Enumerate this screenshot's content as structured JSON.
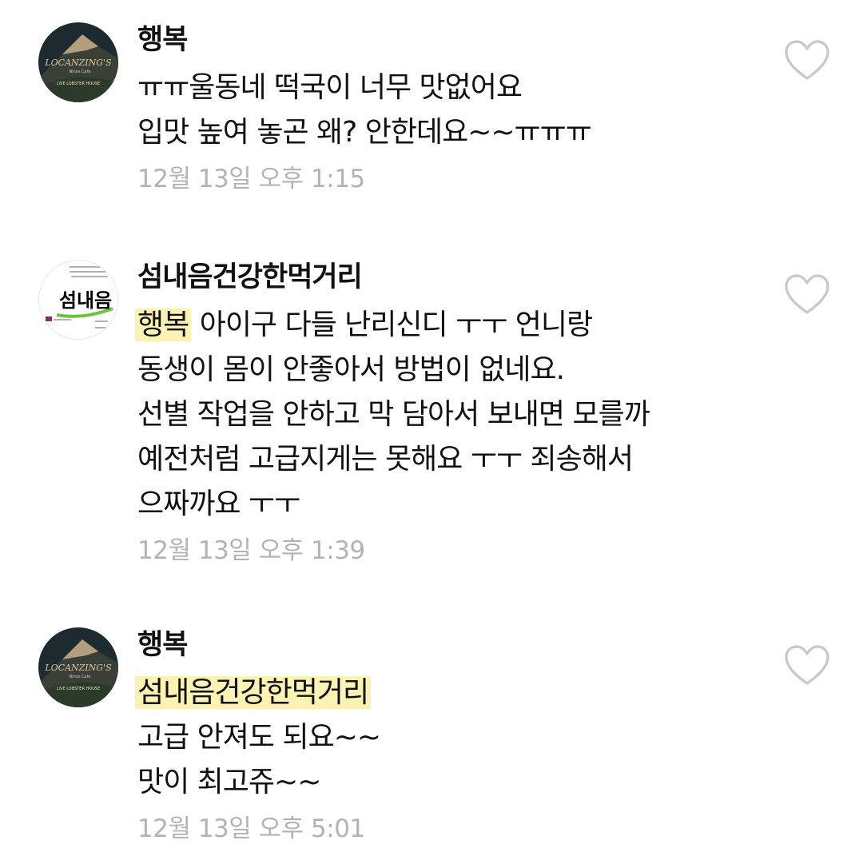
{
  "comments": [
    {
      "author": "행복",
      "lines": [
        "ㅠㅠ울동네 떡국이 너무 맛없어요",
        "입맛 높여 놓곤 왜? 안한데요~~ㅠㅠㅠ"
      ],
      "time": "12월 13일 오후 1:15",
      "avatar_text": [
        "LOCANZING'S",
        "Ninos Cafe",
        "LIVE LOBSTER HOUSE"
      ]
    },
    {
      "author": "섬내음건강한먹거리",
      "mention": "행복",
      "first_line_rest": " 아이구 다들 난리신디 ㅜㅜ 언니랑",
      "lines": [
        "동생이 몸이 안좋아서 방법이 없네요.",
        "선별 작업을 안하고 막 담아서 보내면 모를까",
        "예전처럼 고급지게는 못해요 ㅜㅜ 죄송해서",
        "으짜까요 ㅜㅜ"
      ],
      "time": "12월 13일 오후 1:39",
      "avatar_text": [
        "섬내음"
      ]
    },
    {
      "author": "행복",
      "mention": "섬내음건강한먹거리",
      "lines": [
        "고급 안져도 되요~~",
        "맛이 최고쥬~~"
      ],
      "time": "12월 13일 오후 5:01",
      "avatar_text": [
        "LOCANZING'S",
        "Ninos Cafe",
        "LIVE LOBSTER HOUSE"
      ]
    }
  ]
}
